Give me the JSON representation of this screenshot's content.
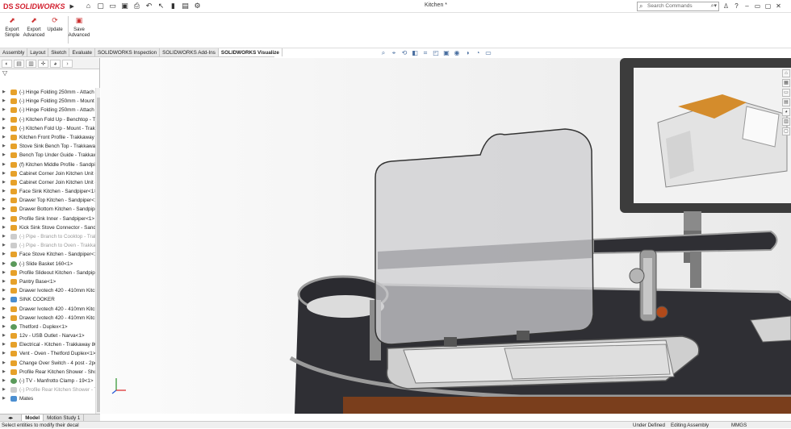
{
  "app": {
    "brand_prefix": "DS",
    "brand_name": "SOLIDWORKS",
    "document_title": "Kitchen *"
  },
  "search": {
    "placeholder": "Search Commands"
  },
  "toolbar_icons": [
    "home-icon",
    "new-icon",
    "open-icon",
    "save-icon",
    "print-icon",
    "undo-icon",
    "select-icon",
    "rebuild-icon",
    "options-icon"
  ],
  "commands": [
    {
      "label": "Export Simple",
      "icon": "export-simple-icon"
    },
    {
      "label": "Export Advanced",
      "icon": "export-advanced-icon"
    },
    {
      "label": "Update",
      "icon": "update-icon"
    },
    {
      "label": "Save Advanced",
      "icon": "save-advanced-icon"
    }
  ],
  "tabs": [
    {
      "label": "Assembly",
      "active": false
    },
    {
      "label": "Layout",
      "active": false
    },
    {
      "label": "Sketch",
      "active": false
    },
    {
      "label": "Evaluate",
      "active": false
    },
    {
      "label": "SOLIDWORKS Inspection",
      "active": false
    },
    {
      "label": "SOLIDWORKS Add-Ins",
      "active": false
    },
    {
      "label": "SOLIDWORKS Visualize",
      "active": true
    }
  ],
  "tree_items": [
    {
      "label": "(-) Hinge Folding 250mm - Attach",
      "kind": "part"
    },
    {
      "label": "(-) Hinge Folding 250mm - Mount",
      "kind": "part"
    },
    {
      "label": "(-) Hinge Folding 250mm - Attach",
      "kind": "part"
    },
    {
      "label": "(-) Kitchen Fold Up - Benchtop - T",
      "kind": "part"
    },
    {
      "label": "(-) Kitchen Fold Up - Mount - Trak",
      "kind": "part"
    },
    {
      "label": "Kitchen Front Profile - Trakkaway 8",
      "kind": "part"
    },
    {
      "label": "Stove Sink Bench Top - Trakkaway",
      "kind": "part"
    },
    {
      "label": "Bench Top Under Guide - Trakkaw",
      "kind": "part"
    },
    {
      "label": "(f) Kitchen Middle Profile - Sandpi",
      "kind": "part"
    },
    {
      "label": "Cabinet Corner Join Kitchen Unit -",
      "kind": "part"
    },
    {
      "label": "Cabinet Corner Join Kitchen Unit -",
      "kind": "part"
    },
    {
      "label": "Face Sink Kitchen - Sandpiper<1>",
      "kind": "part"
    },
    {
      "label": "Drawer Top Kitchen - Sandpiper<1",
      "kind": "part"
    },
    {
      "label": "Drawer Bottom Kitchen - Sandpipe",
      "kind": "part"
    },
    {
      "label": "Profile Sink Inner - Sandpiper<1>",
      "kind": "part"
    },
    {
      "label": "Kick Sink Stove Connector - Sandp",
      "kind": "part"
    },
    {
      "label": "(-) Pipe - Branch to Cooktop - Trak",
      "kind": "supp"
    },
    {
      "label": "(-) Pipe - Branch to Oven - Trakkav",
      "kind": "supp"
    },
    {
      "label": "Face Stove Kitchen - Sandpiper<1>",
      "kind": "part"
    },
    {
      "label": "(-) Slide Basket 160<1>",
      "kind": "cs"
    },
    {
      "label": "Profile Slideout Kitchen - Sandpipe",
      "kind": "part"
    },
    {
      "label": "Pantry Base<1>",
      "kind": "part"
    },
    {
      "label": "Drawer Ivotech 420 - 410mm Kitch",
      "kind": "part"
    },
    {
      "label": "SINK COOKER",
      "kind": "flat"
    },
    {
      "label": "Drawer Ivotech 420 - 410mm Kitch",
      "kind": "part"
    },
    {
      "label": "Drawer Ivotech 420 - 410mm Kitch",
      "kind": "part"
    },
    {
      "label": "Thetford - Duplex<1>",
      "kind": "cs"
    },
    {
      "label": "12v - USB Outlet - Narva<1>",
      "kind": "part"
    },
    {
      "label": "Electrical - Kitchen - Trakkaway 80",
      "kind": "part"
    },
    {
      "label": "Vent - Oven - Thetford Duplex<1>",
      "kind": "part"
    },
    {
      "label": "Change Over Switch - 4 post - 2po",
      "kind": "part"
    },
    {
      "label": "Profile Rear Kitchen Shower - Short",
      "kind": "part"
    },
    {
      "label": "(-) TV - Manfrotto Clamp - 19<1>",
      "kind": "cs"
    },
    {
      "label": "(-) Profile Rear Kitchen Shower - Tr",
      "kind": "supp"
    },
    {
      "label": "Mates",
      "kind": "flat"
    }
  ],
  "bottom_tabs": [
    {
      "label": "Model",
      "active": true
    },
    {
      "label": "Motion Study 1",
      "active": false
    }
  ],
  "status": {
    "hint": "Select entities to modify their decal",
    "state": "Under Defined",
    "mode": "Editing Assembly",
    "units": "MMGS"
  },
  "colors": {
    "brand": "#d2202f",
    "countertop": "#2f2f34",
    "wood": "#7a3e1c"
  }
}
